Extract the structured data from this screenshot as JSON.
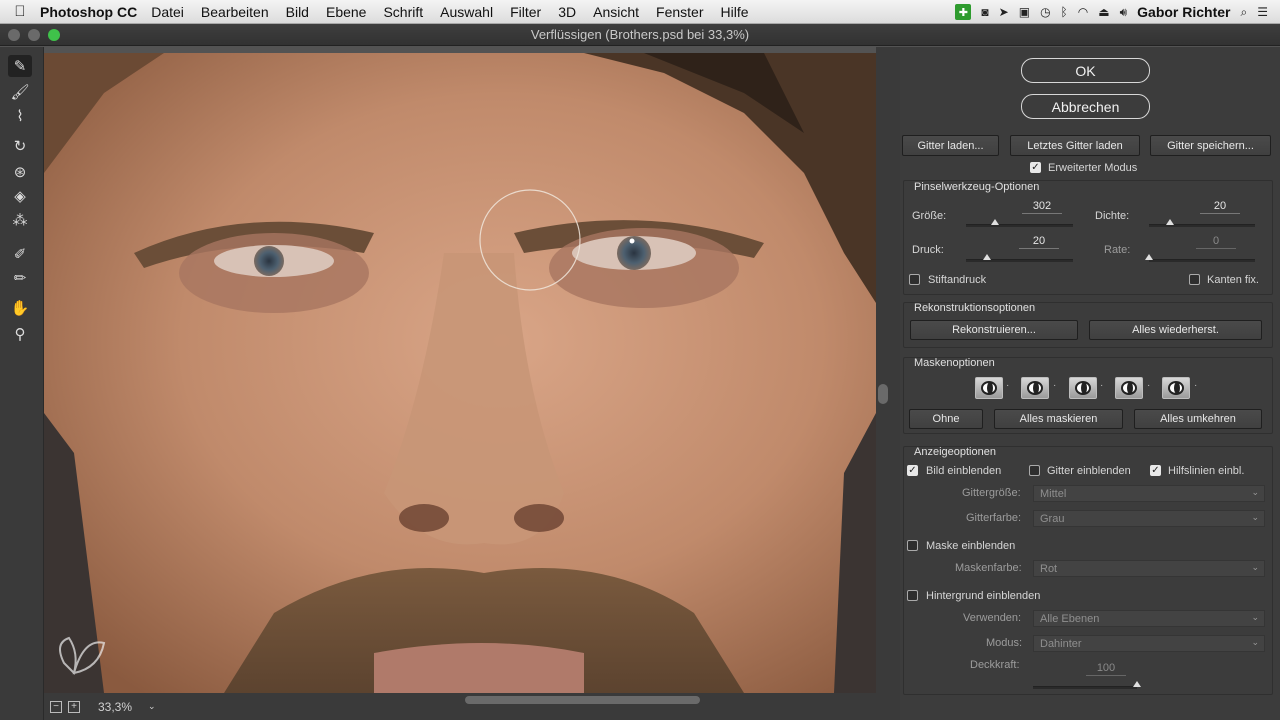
{
  "menubar": {
    "app": "Photoshop CC",
    "items": [
      "Datei",
      "Bearbeiten",
      "Bild",
      "Ebene",
      "Schrift",
      "Auswahl",
      "Filter",
      "3D",
      "Ansicht",
      "Fenster",
      "Hilfe"
    ],
    "user": "Gabor Richter"
  },
  "window": {
    "title": "Verflüssigen (Brothers.psd bei 33,3%)"
  },
  "tools": [
    "forward-warp-tool",
    "reconstruct-tool",
    "smooth-tool",
    "twirl-tool",
    "pucker-tool",
    "bloat-tool",
    "push-left-tool",
    "freeze-mask-tool",
    "thaw-mask-tool",
    "hand-tool",
    "zoom-tool"
  ],
  "bottombar": {
    "minus": "−",
    "plus": "+",
    "zoom": "33,3%"
  },
  "dialog": {
    "ok": "OK",
    "cancel": "Abbrechen",
    "load_mesh": "Gitter laden...",
    "load_last_mesh": "Letztes Gitter laden",
    "save_mesh": "Gitter speichern...",
    "advanced_mode": "Erweiterter Modus"
  },
  "brush": {
    "title": "Pinselwerkzeug-Optionen",
    "size_label": "Größe:",
    "size": "302",
    "size_pct": 0.27,
    "density_label": "Dichte:",
    "density": "20",
    "density_pct": 0.2,
    "pressure_label": "Druck:",
    "pressure": "20",
    "pressure_pct": 0.2,
    "rate_label": "Rate:",
    "rate": "0",
    "rate_pct": 0.0,
    "stylus": "Stiftandruck",
    "pin_edges": "Kanten fix."
  },
  "reconstruct": {
    "title": "Rekonstruktionsoptionen",
    "reconstruct": "Rekonstruieren...",
    "restore_all": "Alles wiederherst."
  },
  "mask": {
    "title": "Maskenoptionen",
    "none": "Ohne",
    "mask_all": "Alles maskieren",
    "invert_all": "Alles umkehren"
  },
  "view": {
    "title": "Anzeigeoptionen",
    "show_image": "Bild einblenden",
    "show_mesh": "Gitter einblenden",
    "show_guides": "Hilfslinien einbl.",
    "mesh_size_label": "Gittergröße:",
    "mesh_size": "Mittel",
    "mesh_color_label": "Gitterfarbe:",
    "mesh_color": "Grau",
    "show_mask": "Maske einblenden",
    "mask_color_label": "Maskenfarbe:",
    "mask_color": "Rot",
    "show_backdrop": "Hintergrund einblenden",
    "use_label": "Verwenden:",
    "use": "Alle Ebenen",
    "mode_label": "Modus:",
    "mode": "Dahinter",
    "opacity_label": "Deckkraft:",
    "opacity": "100",
    "opacity_pct": 1.0
  }
}
